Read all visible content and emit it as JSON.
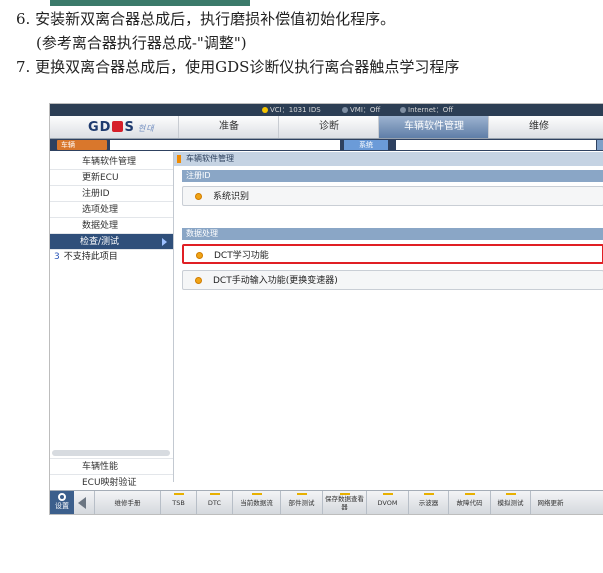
{
  "doc": {
    "line1": "6. 安装新双离合器总成后，执行磨损补偿值初始化程序。",
    "line2": "(参考离合器执行器总成-\"调整\")",
    "line3": "7. 更换双离合器总成后，使用GDS诊断仪执行离合器触点学习程序"
  },
  "screen": {
    "status": {
      "item1": "VCI：1031 IDS",
      "item2": "VMI：Off",
      "item3": "Internet：Off"
    },
    "logo": {
      "text": "GD",
      "text2": "S",
      "sub": "현대"
    },
    "tabs": [
      "准备",
      "诊断",
      "车辆软件管理",
      "维修"
    ],
    "crumb": {
      "vehicle": "车辆",
      "system": "系统"
    },
    "sidebar": {
      "items": [
        "车辆软件管理",
        "更新ECU",
        "注册ID",
        "选项处理",
        "数据处理",
        "检查/测试"
      ],
      "unsupported_num": "3",
      "unsupported": "不支持此项目",
      "bottom": [
        "车辆性能",
        "ECU映射验证"
      ]
    },
    "main": {
      "title": "车辆软件管理",
      "section1": "注册ID",
      "opt1": "系统识别",
      "section2": "数据处理",
      "opt2": "DCT学习功能",
      "opt3": "DCT手动输入功能(更换变速器)"
    },
    "toolbar": {
      "home": "设置",
      "buttons": [
        "维修手册",
        "TSB",
        "DTC",
        "当前数据流",
        "部件测试",
        "保存数据查看器",
        "DVOM",
        "示波器",
        "故障代码",
        "模拟测试",
        "网络更新"
      ]
    },
    "colors": {
      "highlight": "#e01f24",
      "accent": "#f08a00",
      "nav": "#2f4f7a"
    }
  }
}
